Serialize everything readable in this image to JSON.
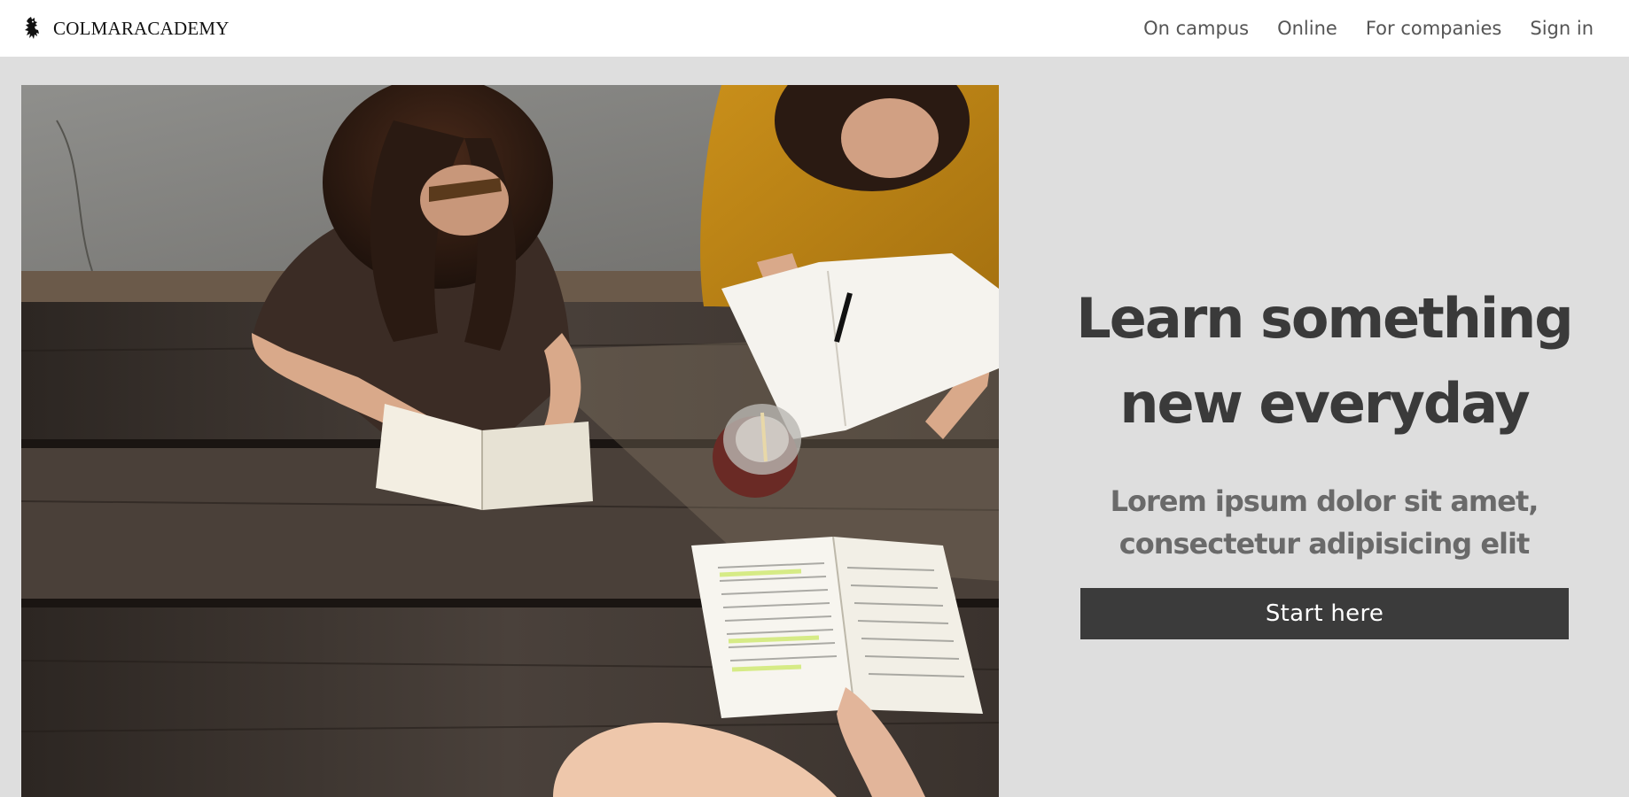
{
  "header": {
    "brand_name": "COLMARACADEMY",
    "logo_icon": "heraldic-lion-icon",
    "nav": [
      {
        "label": "On campus"
      },
      {
        "label": "Online"
      },
      {
        "label": "For companies"
      },
      {
        "label": "Sign in"
      }
    ]
  },
  "hero": {
    "image_subject": "students reading and writing at a wooden picnic table",
    "title": "Learn something new everyday",
    "subtitle": "Lorem ipsum dolor sit amet, consectetur adipisicing elit",
    "cta_label": "Start here"
  },
  "colors": {
    "page_background": "#dedede",
    "header_background": "#ffffff",
    "button_background": "#3b3b3b",
    "title_text": "#3a3a3a",
    "subtitle_text": "#6a6a6a",
    "nav_text": "#555555"
  }
}
